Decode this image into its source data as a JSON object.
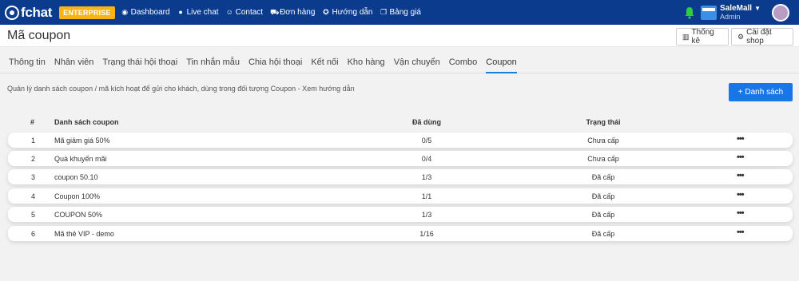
{
  "brand": {
    "name": "fchat",
    "edition": "ENTERPRISE"
  },
  "nav": [
    {
      "icon": "dashboard-icon",
      "label": "Dashboard"
    },
    {
      "icon": "live-chat-icon",
      "label": "Live chat"
    },
    {
      "icon": "contact-icon",
      "label": "Contact"
    },
    {
      "icon": "cart-icon",
      "label": "Đơn hàng"
    },
    {
      "icon": "help-icon",
      "label": "Hướng dẫn"
    },
    {
      "icon": "pricing-icon",
      "label": "Bảng giá"
    }
  ],
  "user": {
    "name": "SaleMall",
    "role": "Admin"
  },
  "header": {
    "title": "Mã coupon",
    "stats_label": "Thống kê",
    "settings_label": "Cài đặt shop"
  },
  "tabs": [
    "Thông tin",
    "Nhân viên",
    "Trạng thái hội thoại",
    "Tin nhắn mẫu",
    "Chia hội thoại",
    "Kết nối",
    "Kho hàng",
    "Vận chuyển",
    "Combo",
    "Coupon"
  ],
  "active_tab": "Coupon",
  "description": "Quản lý danh sách coupon / mã kích hoạt để gửi cho khách, dùng trong đối tượng Coupon - Xem hướng dẫn",
  "add_button": "+ Danh sách",
  "table": {
    "columns": [
      "#",
      "Danh sách coupon",
      "Đã dùng",
      "Trạng thái"
    ],
    "rows": [
      {
        "idx": "1",
        "name": "Mã giảm giá 50%",
        "used": "0/5",
        "status": "Chưa cấp"
      },
      {
        "idx": "2",
        "name": "Quà khuyến mãi",
        "used": "0/4",
        "status": "Chưa cấp"
      },
      {
        "idx": "3",
        "name": "coupon 50.10",
        "used": "1/3",
        "status": "Đã cấp"
      },
      {
        "idx": "4",
        "name": "Coupon 100%",
        "used": "1/1",
        "status": "Đã cấp"
      },
      {
        "idx": "5",
        "name": "COUPON 50%",
        "used": "1/3",
        "status": "Đã cấp"
      },
      {
        "idx": "6",
        "name": "Mã thẻ VIP - demo",
        "used": "1/16",
        "status": "Đã cấp"
      }
    ],
    "more_glyph": "•••"
  },
  "colors": {
    "topbar": "#0a3b8c",
    "accent": "#1976e8",
    "enterprise_badge": "#f9b312",
    "bell": "#2ecc40"
  }
}
